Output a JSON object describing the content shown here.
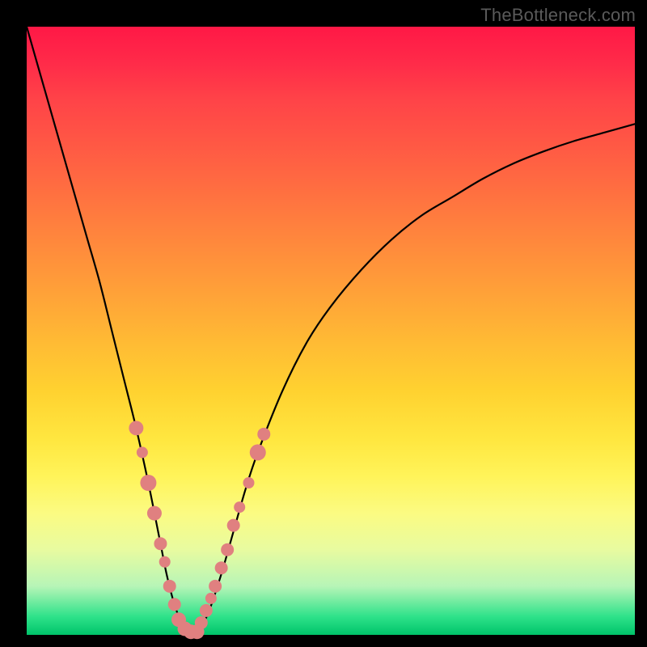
{
  "attribution": "TheBottleneck.com",
  "colors": {
    "marker": "#e08080",
    "curve": "#000000",
    "frame": "#000000"
  },
  "chart_data": {
    "type": "line",
    "title": "",
    "xlabel": "",
    "ylabel": "",
    "xlim": [
      0,
      100
    ],
    "ylim": [
      0,
      100
    ],
    "grid": false,
    "legend": false,
    "series": [
      {
        "name": "bottleneck-curve",
        "x": [
          0,
          2,
          4,
          6,
          8,
          10,
          12,
          14,
          16,
          18,
          20,
          22,
          23,
          24,
          25,
          26,
          27,
          28,
          30,
          32,
          34,
          36,
          38,
          42,
          46,
          50,
          55,
          60,
          65,
          70,
          75,
          80,
          85,
          90,
          95,
          100
        ],
        "y": [
          100,
          93,
          86,
          79,
          72,
          65,
          58,
          50,
          42,
          34,
          25,
          15,
          10,
          6,
          3,
          1,
          0,
          0,
          4,
          10,
          17,
          24,
          30,
          40,
          48,
          54,
          60,
          65,
          69,
          72,
          75,
          77.5,
          79.5,
          81.2,
          82.6,
          84
        ]
      }
    ],
    "markers": {
      "name": "highlight-points",
      "points": [
        {
          "x": 18,
          "y": 34,
          "r": 9
        },
        {
          "x": 19,
          "y": 30,
          "r": 7
        },
        {
          "x": 20,
          "y": 25,
          "r": 10
        },
        {
          "x": 21,
          "y": 20,
          "r": 9
        },
        {
          "x": 22,
          "y": 15,
          "r": 8
        },
        {
          "x": 22.7,
          "y": 12,
          "r": 7
        },
        {
          "x": 23.5,
          "y": 8,
          "r": 8
        },
        {
          "x": 24.3,
          "y": 5,
          "r": 8
        },
        {
          "x": 25,
          "y": 2.5,
          "r": 9
        },
        {
          "x": 26,
          "y": 1,
          "r": 9
        },
        {
          "x": 27,
          "y": 0.5,
          "r": 9
        },
        {
          "x": 28,
          "y": 0.5,
          "r": 9
        },
        {
          "x": 28.7,
          "y": 2,
          "r": 8
        },
        {
          "x": 29.5,
          "y": 4,
          "r": 8
        },
        {
          "x": 30.3,
          "y": 6,
          "r": 7
        },
        {
          "x": 31,
          "y": 8,
          "r": 8
        },
        {
          "x": 32,
          "y": 11,
          "r": 8
        },
        {
          "x": 33,
          "y": 14,
          "r": 8
        },
        {
          "x": 34,
          "y": 18,
          "r": 8
        },
        {
          "x": 35,
          "y": 21,
          "r": 7
        },
        {
          "x": 36.5,
          "y": 25,
          "r": 7
        },
        {
          "x": 38,
          "y": 30,
          "r": 10
        },
        {
          "x": 39,
          "y": 33,
          "r": 8
        }
      ]
    }
  }
}
